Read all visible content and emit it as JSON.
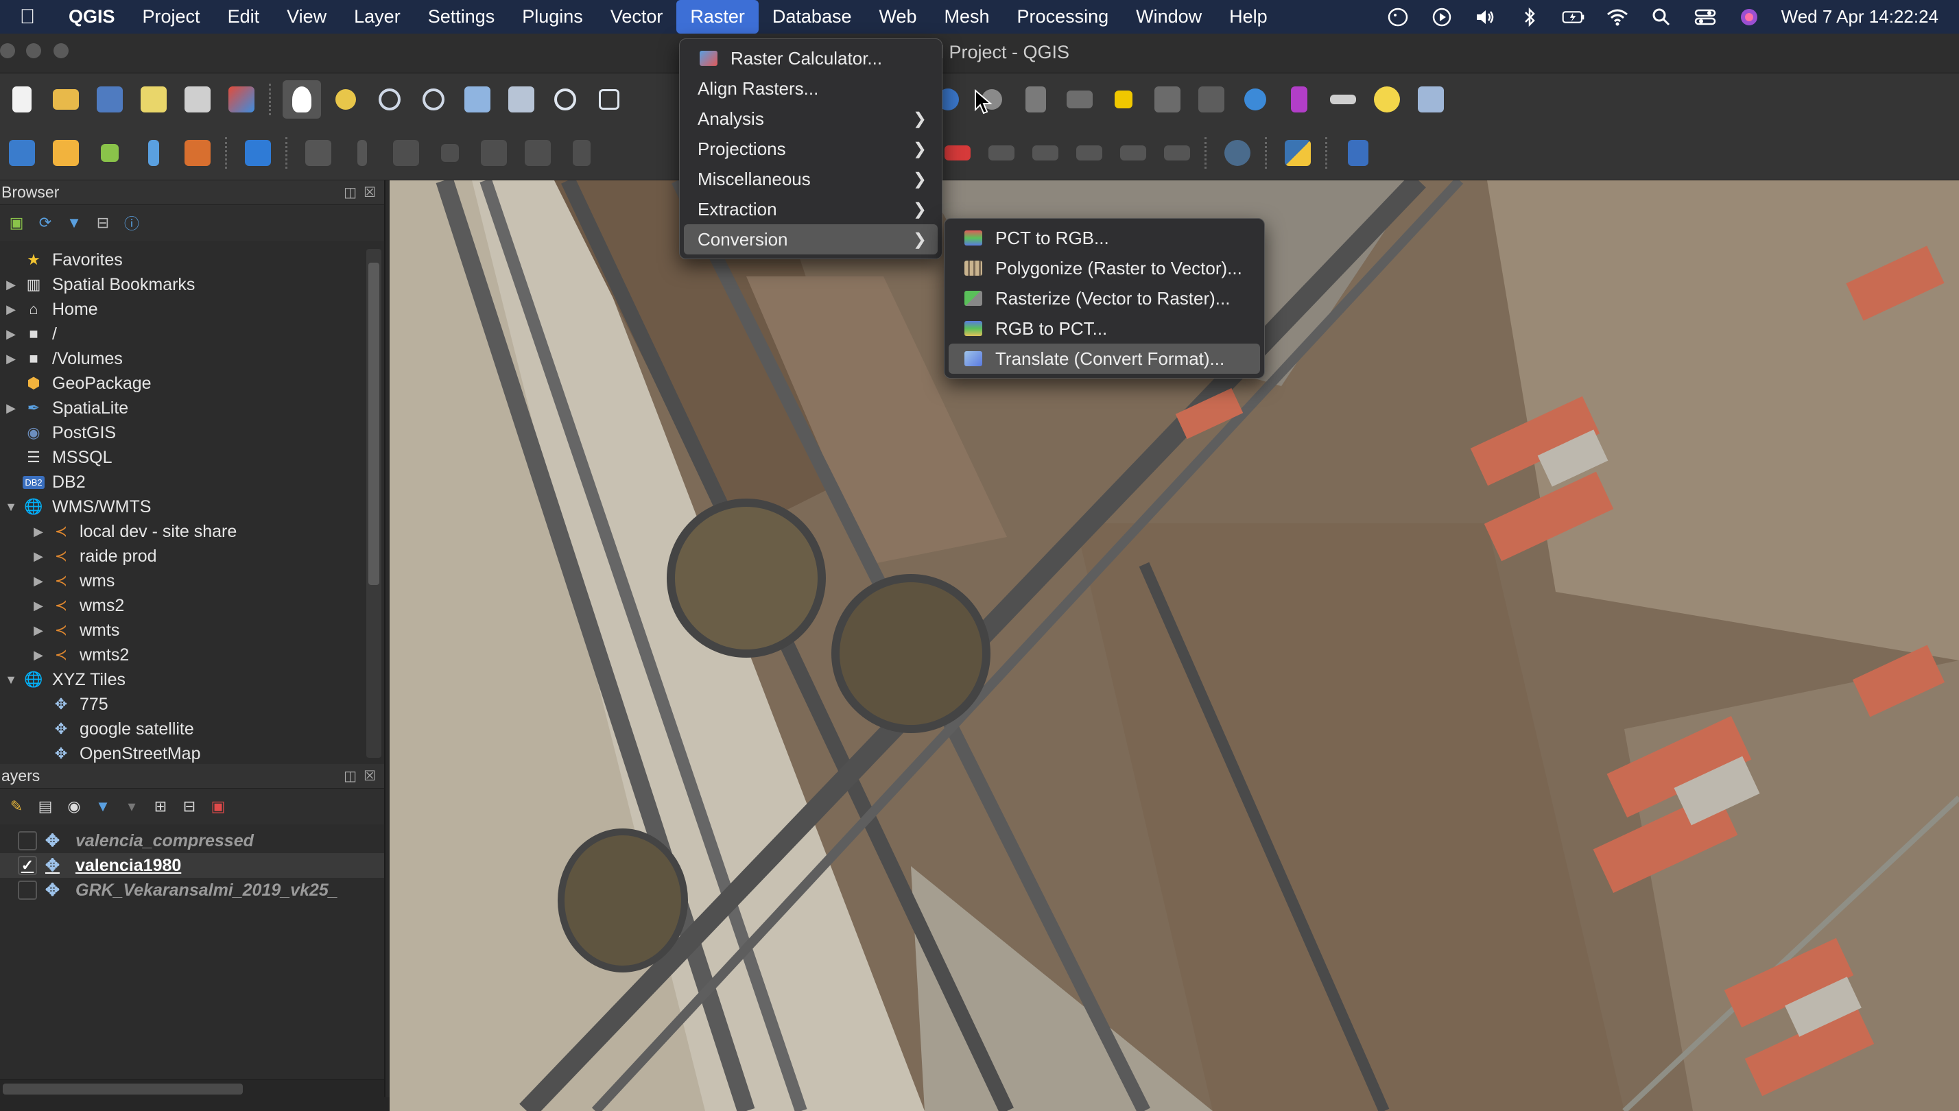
{
  "menubar": {
    "app": "QGIS",
    "items": [
      "Project",
      "Edit",
      "View",
      "Layer",
      "Settings",
      "Plugins",
      "Vector",
      "Raster",
      "Database",
      "Web",
      "Mesh",
      "Processing",
      "Window",
      "Help"
    ],
    "active": "Raster",
    "clock": "Wed 7 Apr  14:22:24"
  },
  "window": {
    "title": "l Project - QGIS"
  },
  "browser": {
    "title": "Browser",
    "items": [
      {
        "label": "Favorites",
        "icon": "star-icon"
      },
      {
        "label": "Spatial Bookmarks",
        "icon": "bookmark-icon"
      },
      {
        "label": "Home",
        "icon": "home-icon"
      },
      {
        "label": "/",
        "icon": "folder-icon"
      },
      {
        "label": "/Volumes",
        "icon": "folder-icon"
      },
      {
        "label": "GeoPackage",
        "icon": "geopackage-icon"
      },
      {
        "label": "SpatiaLite",
        "icon": "spatialite-icon"
      },
      {
        "label": "PostGIS",
        "icon": "postgis-icon"
      },
      {
        "label": "MSSQL",
        "icon": "mssql-icon"
      },
      {
        "label": "DB2",
        "icon": "db2-icon"
      },
      {
        "label": "WMS/WMTS",
        "icon": "globe-icon"
      },
      {
        "label": "local dev - site share",
        "icon": "wms-icon"
      },
      {
        "label": "raide prod",
        "icon": "wms-icon"
      },
      {
        "label": "wms",
        "icon": "wms-icon"
      },
      {
        "label": "wms2",
        "icon": "wms-icon"
      },
      {
        "label": "wmts",
        "icon": "wms-icon"
      },
      {
        "label": "wmts2",
        "icon": "wms-icon"
      },
      {
        "label": "XYZ Tiles",
        "icon": "globe-icon"
      },
      {
        "label": "775",
        "icon": "xyz-icon"
      },
      {
        "label": "google satellite",
        "icon": "xyz-icon"
      },
      {
        "label": "OpenStreetMap",
        "icon": "xyz-icon"
      }
    ]
  },
  "layers": {
    "title": "ayers",
    "items": [
      {
        "label": "valencia_compressed",
        "checked": false
      },
      {
        "label": "valencia1980",
        "checked": true
      },
      {
        "label": "GRK_Vekaransalmi_2019_vk25_",
        "checked": false
      }
    ]
  },
  "raster_menu": {
    "items": [
      {
        "label": "Raster Calculator...",
        "submenu": false
      },
      {
        "label": "Align Rasters...",
        "submenu": false
      },
      {
        "label": "Analysis",
        "submenu": true
      },
      {
        "label": "Projections",
        "submenu": true
      },
      {
        "label": "Miscellaneous",
        "submenu": true
      },
      {
        "label": "Extraction",
        "submenu": true
      },
      {
        "label": "Conversion",
        "submenu": true
      }
    ],
    "highlighted": "Conversion"
  },
  "conversion_menu": {
    "items": [
      {
        "label": "PCT to RGB..."
      },
      {
        "label": "Polygonize (Raster to Vector)..."
      },
      {
        "label": "Rasterize (Vector to Raster)..."
      },
      {
        "label": "RGB to PCT..."
      },
      {
        "label": "Translate (Convert Format)..."
      }
    ],
    "highlighted": "Translate (Convert Format)..."
  },
  "colors": {
    "accent": "#3d6fd6",
    "menu_bg": "#2f2f31",
    "highlight": "#585858"
  }
}
